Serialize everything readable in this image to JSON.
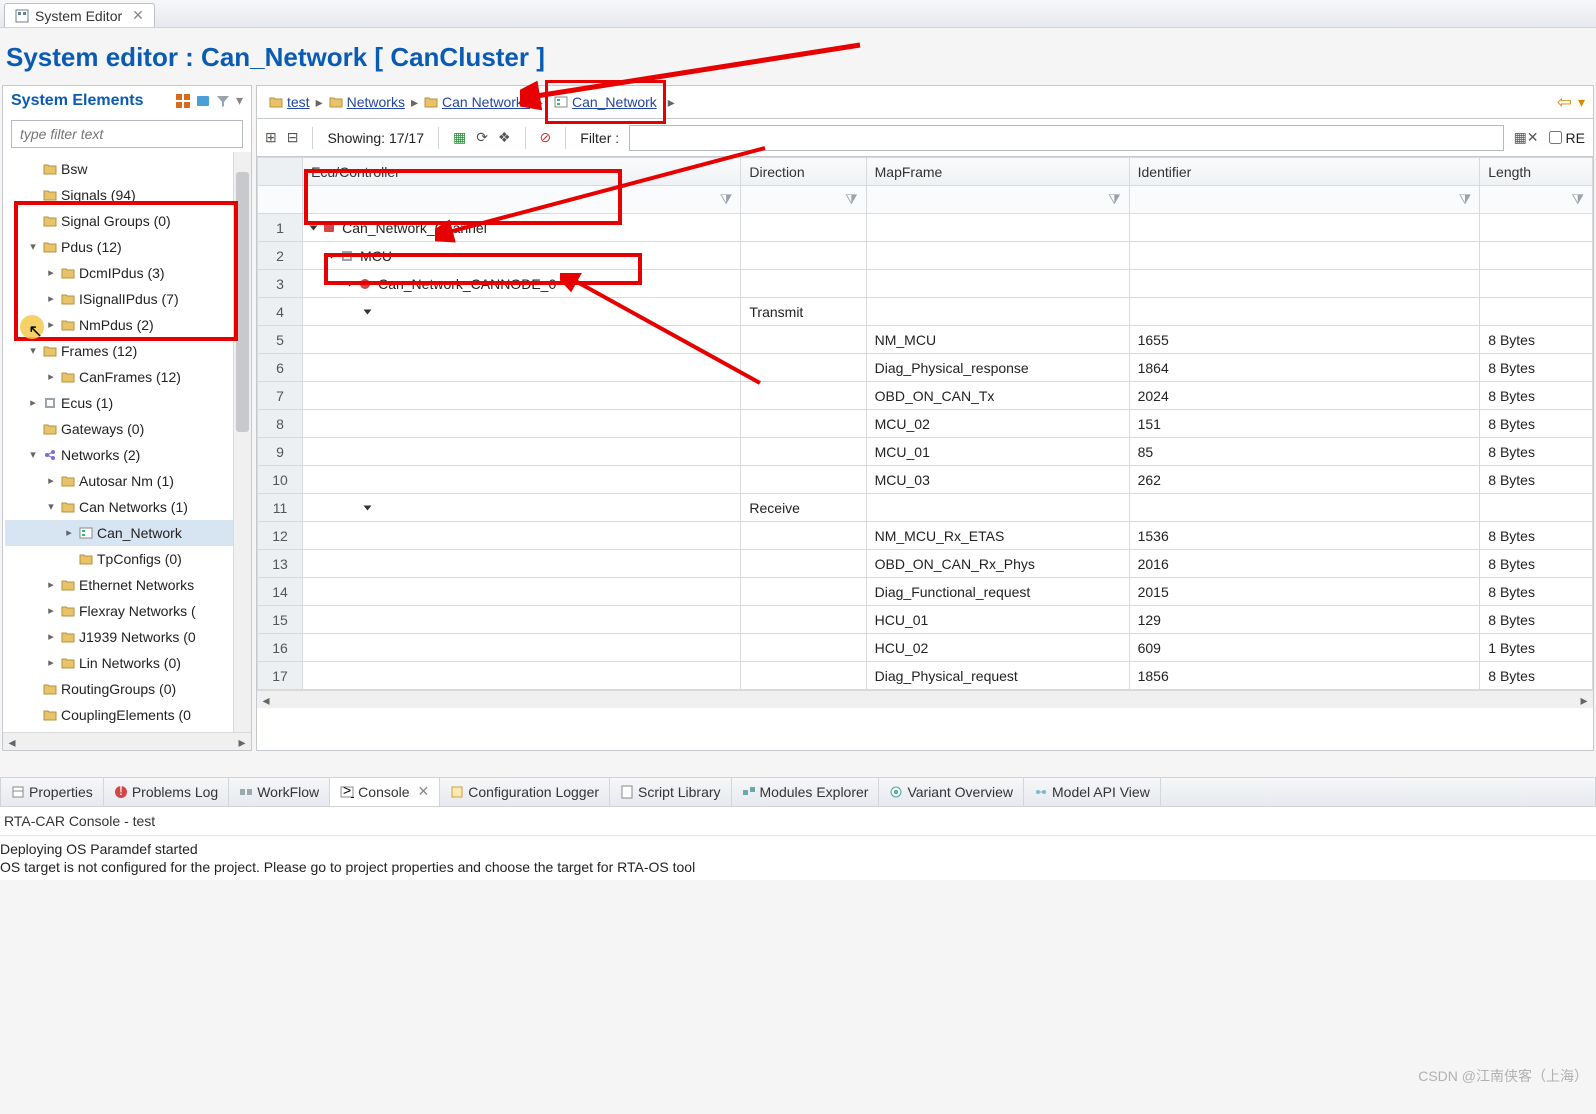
{
  "tab": {
    "title": "System Editor"
  },
  "page_title": "System editor : Can_Network  [ CanCluster ]",
  "left": {
    "panel_title": "System Elements",
    "filter_placeholder": "type filter text",
    "tree": [
      {
        "indent": 1,
        "exp": "",
        "icon": "fld",
        "label": "Bsw"
      },
      {
        "indent": 1,
        "exp": "",
        "icon": "fld",
        "label": "Signals (94)"
      },
      {
        "indent": 1,
        "exp": "",
        "icon": "fld",
        "label": "Signal Groups (0)"
      },
      {
        "indent": 1,
        "exp": "v",
        "icon": "fld",
        "label": "Pdus (12)"
      },
      {
        "indent": 2,
        "exp": ">",
        "icon": "fld",
        "label": "DcmIPdus (3)"
      },
      {
        "indent": 2,
        "exp": ">",
        "icon": "fld",
        "label": "ISignalIPdus (7)"
      },
      {
        "indent": 2,
        "exp": ">",
        "icon": "fld",
        "label": "NmPdus (2)"
      },
      {
        "indent": 1,
        "exp": "v",
        "icon": "fld",
        "label": "Frames (12)"
      },
      {
        "indent": 2,
        "exp": ">",
        "icon": "fld",
        "label": "CanFrames (12)"
      },
      {
        "indent": 1,
        "exp": ">",
        "icon": "chip",
        "label": "Ecus (1)"
      },
      {
        "indent": 1,
        "exp": "",
        "icon": "fld",
        "label": "Gateways (0)"
      },
      {
        "indent": 1,
        "exp": "v",
        "icon": "net",
        "label": "Networks (2)"
      },
      {
        "indent": 2,
        "exp": ">",
        "icon": "fld",
        "label": "Autosar Nm (1)"
      },
      {
        "indent": 2,
        "exp": "v",
        "icon": "fld",
        "label": "Can Networks (1)"
      },
      {
        "indent": 3,
        "exp": ">",
        "icon": "cfg",
        "label": "Can_Network",
        "selected": true
      },
      {
        "indent": 3,
        "exp": "",
        "icon": "fld",
        "label": "TpConfigs (0)"
      },
      {
        "indent": 2,
        "exp": ">",
        "icon": "fld",
        "label": "Ethernet Networks"
      },
      {
        "indent": 2,
        "exp": ">",
        "icon": "fld",
        "label": "Flexray Networks ("
      },
      {
        "indent": 2,
        "exp": ">",
        "icon": "fld",
        "label": "J1939 Networks (0"
      },
      {
        "indent": 2,
        "exp": ">",
        "icon": "fld",
        "label": "Lin Networks (0)"
      },
      {
        "indent": 1,
        "exp": "",
        "icon": "fld",
        "label": "RoutingGroups (0)"
      },
      {
        "indent": 1,
        "exp": "",
        "icon": "fld",
        "label": "CouplingElements (0"
      }
    ]
  },
  "breadcrumbs": [
    {
      "label": "test",
      "underline": true,
      "icon": "folder"
    },
    {
      "label": "Networks",
      "underline": true,
      "icon": "fld"
    },
    {
      "label": "Can Networks",
      "underline": true,
      "icon": "fld"
    },
    {
      "label": "Can_Network",
      "underline": true,
      "icon": "cfg",
      "highlight": true
    }
  ],
  "toolbar": {
    "showing": "Showing: 17/17",
    "filter_label": "Filter :",
    "re_label": "RE"
  },
  "columns": [
    "",
    "Ecu/Controller",
    "Direction",
    "MapFrame",
    "Identifier",
    "Length"
  ],
  "rows": [
    {
      "n": 1,
      "ecu": "Can_Network_Channel",
      "ind": 1,
      "tri": "down",
      "icon": "cluster"
    },
    {
      "n": 2,
      "ecu": "MCU",
      "ind": 2,
      "tri": "down",
      "icon": "chip"
    },
    {
      "n": 3,
      "ecu": "Can_Network_CANNODE_0",
      "ind": 3,
      "tri": "down",
      "icon": "node"
    },
    {
      "n": 4,
      "ecu": "",
      "ind": 4,
      "tri": "down",
      "dir": "Transmit"
    },
    {
      "n": 5,
      "map": "NM_MCU",
      "id": "1655",
      "len": "8 Bytes"
    },
    {
      "n": 6,
      "map": "Diag_Physical_response",
      "id": "1864",
      "len": "8 Bytes"
    },
    {
      "n": 7,
      "map": "OBD_ON_CAN_Tx",
      "id": "2024",
      "len": "8 Bytes"
    },
    {
      "n": 8,
      "map": "MCU_02",
      "id": "151",
      "len": "8 Bytes"
    },
    {
      "n": 9,
      "map": "MCU_01",
      "id": "85",
      "len": "8 Bytes"
    },
    {
      "n": 10,
      "map": "MCU_03",
      "id": "262",
      "len": "8 Bytes"
    },
    {
      "n": 11,
      "ecu": "",
      "ind": 4,
      "tri": "down",
      "dir": "Receive"
    },
    {
      "n": 12,
      "map": "NM_MCU_Rx_ETAS",
      "id": "1536",
      "len": "8 Bytes"
    },
    {
      "n": 13,
      "map": "OBD_ON_CAN_Rx_Phys",
      "id": "2016",
      "len": "8 Bytes"
    },
    {
      "n": 14,
      "map": "Diag_Functional_request",
      "id": "2015",
      "len": "8 Bytes"
    },
    {
      "n": 15,
      "map": "HCU_01",
      "id": "129",
      "len": "8 Bytes"
    },
    {
      "n": 16,
      "map": "HCU_02",
      "id": "609",
      "len": "1 Bytes"
    },
    {
      "n": 17,
      "map": "Diag_Physical_request",
      "id": "1856",
      "len": "8 Bytes"
    }
  ],
  "bottom_tabs": [
    {
      "label": "Properties",
      "icon": "props"
    },
    {
      "label": "Problems Log",
      "icon": "warn"
    },
    {
      "label": "WorkFlow",
      "icon": "flow"
    },
    {
      "label": "Console",
      "icon": "cons",
      "active": true,
      "closable": true
    },
    {
      "label": "Configuration Logger",
      "icon": "cfglog"
    },
    {
      "label": "Script Library",
      "icon": "scr"
    },
    {
      "label": "Modules Explorer",
      "icon": "mod"
    },
    {
      "label": "Variant Overview",
      "icon": "var"
    },
    {
      "label": "Model API View",
      "icon": "api"
    }
  ],
  "console": {
    "header": "RTA-CAR Console - test",
    "line1": "Deploying OS Paramdef started",
    "line2": "OS target is not configured for the project. Please go to project properties and choose the target for RTA-OS tool"
  },
  "watermark": "CSDN @江南侠客（上海）"
}
